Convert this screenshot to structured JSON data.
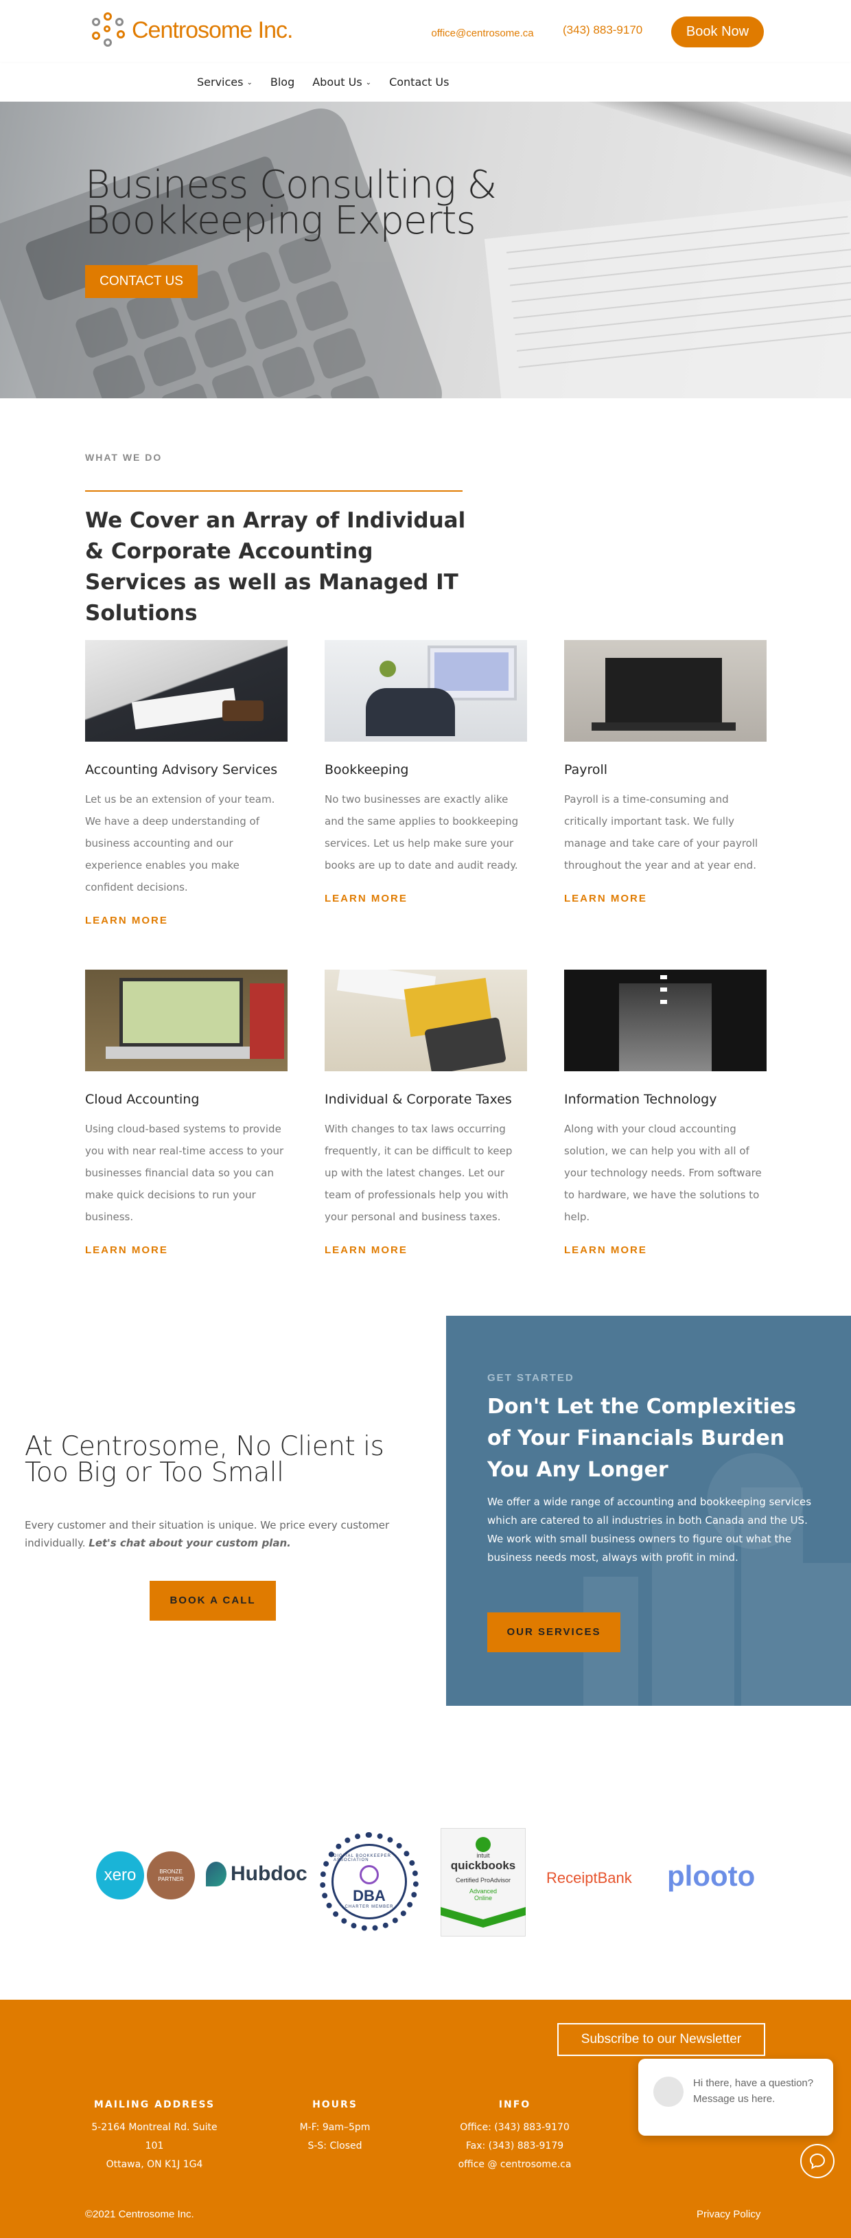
{
  "header": {
    "logo_text": "Centrosome Inc.",
    "email": "office@centrosome.ca",
    "phone": "(343) 883-9170",
    "book_now": "Book Now"
  },
  "nav": {
    "items": [
      {
        "label": "Services",
        "has_dropdown": true
      },
      {
        "label": "Blog",
        "has_dropdown": false
      },
      {
        "label": "About Us",
        "has_dropdown": true
      },
      {
        "label": "Contact Us",
        "has_dropdown": false
      }
    ],
    "chevron": "⌄"
  },
  "hero": {
    "title": "Business Consulting & Bookkeeping Experts",
    "cta": "CONTACT US"
  },
  "what_we_do": {
    "eyebrow": "WHAT WE DO",
    "title": "We Cover an Array of Individual & Corporate Accounting Services as well as Managed IT Solutions",
    "services": [
      {
        "title": "Accounting Advisory Services",
        "text": "Let us be an extension of your team. We have a deep understanding of business accounting and our experience enables you make confident decisions.",
        "more": "LEARN MORE"
      },
      {
        "title": "Bookkeeping",
        "text": "No two businesses are exactly alike and the same applies to bookkeeping services.  Let us help make sure your books are up to date and audit ready.",
        "more": "LEARN MORE"
      },
      {
        "title": "Payroll",
        "text": "Payroll is a time-consuming and critically important task. We fully manage and take care of your payroll throughout the year and at year end.",
        "more": "LEARN MORE"
      },
      {
        "title": "Cloud Accounting",
        "text": "Using cloud-based systems to provide you with near real-time access to your businesses financial data so you can make quick decisions to run your business.",
        "more": "LEARN MORE"
      },
      {
        "title": "Individual & Corporate Taxes",
        "text": "With changes to tax laws occurring frequently, it can be difficult to keep up with the latest changes. Let our team of professionals help you with your personal and business taxes.",
        "more": "LEARN MORE"
      },
      {
        "title": "Information Technology",
        "text": "Along with your cloud accounting solution, we can help you with all of your technology needs. From software to hardware, we have the solutions to help.",
        "more": "LEARN MORE"
      }
    ]
  },
  "left_cta": {
    "title": "At Centrosome, No Client is Too Big or Too Small",
    "text": "Every customer and their situation is unique. We price every customer individually.",
    "text_emphasis": "Let's chat about your custom plan.",
    "button": "BOOK A CALL"
  },
  "blue_cta": {
    "eyebrow": "GET STARTED",
    "title": "Don't Let the Complexities of Your Financials Burden You Any Longer",
    "text": "We offer a wide range of accounting and bookkeeping services which are catered to all industries in both Canada and the US. We work with small business owners to figure out what the business needs most, always with profit in mind.",
    "button": "OUR SERVICES"
  },
  "partners": {
    "xero": "xero",
    "xero_badge_line1": "BRONZE",
    "xero_badge_line2": "PARTNER",
    "hubdoc": "Hubdoc",
    "dba": "DBA",
    "dba_sub": "CHARTER MEMBER",
    "dba_ring": "DIGITAL BOOKKEEPER ASSOCIATION",
    "qb_intuit": "intuit",
    "qb_name": "quickbooks",
    "qb_certified": "Certified ProAdvisor",
    "qb_level": "Advanced",
    "qb_online": "Online",
    "receipt_bank": "ReceiptBank",
    "plooto": "plooto"
  },
  "footer": {
    "newsletter": "Subscribe to our Newsletter",
    "mailing": {
      "heading": "MAILING ADDRESS",
      "lines": [
        "5-2164 Montreal Rd. Suite",
        "101",
        "Ottawa, ON K1J 1G4"
      ]
    },
    "hours": {
      "heading": "HOURS",
      "lines": [
        "M-F: 9am–5pm",
        "S-S: Closed"
      ]
    },
    "info": {
      "heading": "INFO",
      "lines": [
        "Office: (343) 883-9170",
        "Fax: (343) 883-9179",
        "office @ centrosome.ca"
      ]
    },
    "chat_message": "Hi there, have a question? Message us here.",
    "copyright": "©2021 Centrosome Inc.",
    "privacy": "Privacy Policy"
  },
  "colors": {
    "accent": "#e07b00",
    "blue_panel": "#4e7895"
  }
}
